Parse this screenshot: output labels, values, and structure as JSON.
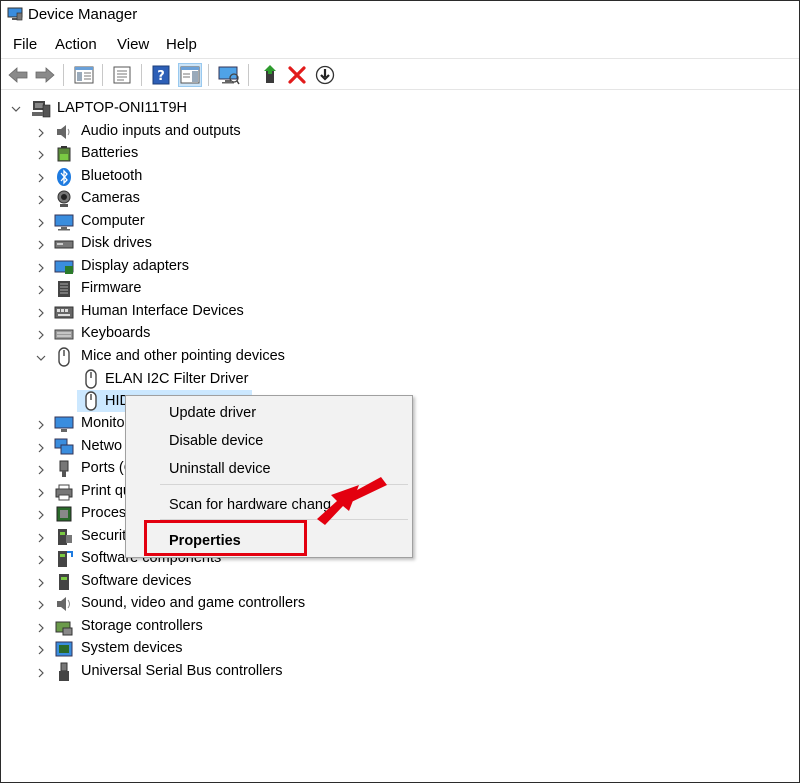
{
  "window": {
    "title": "Device Manager"
  },
  "menu": [
    "File",
    "Action",
    "View",
    "Help"
  ],
  "toolbar": {
    "buttons": [
      "back-icon",
      "forward-icon",
      "show-hide-console-tree-icon",
      "properties-icon",
      "help-icon",
      "action-pane-icon",
      "scan-hardware-icon",
      "update-driver-icon",
      "uninstall-device-icon",
      "disable-device-icon"
    ]
  },
  "tree": {
    "root": "LAPTOP-ONI11T9H",
    "categories": [
      "Audio inputs and outputs",
      "Batteries",
      "Bluetooth",
      "Cameras",
      "Computer",
      "Disk drives",
      "Display adapters",
      "Firmware",
      "Human Interface Devices",
      "Keyboards",
      "Mice and other pointing devices",
      "Monito",
      "Netwo",
      "Ports (C",
      "Print qu",
      "Process",
      "Securit",
      "Software components",
      "Software devices",
      "Sound, video and game controllers",
      "Storage controllers",
      "System devices",
      "Universal Serial Bus controllers"
    ],
    "mice_children": [
      "ELAN I2C Filter Driver",
      "HID"
    ]
  },
  "context_menu": {
    "items": [
      "Update driver",
      "Disable device",
      "Uninstall device",
      "Scan for hardware chang",
      "Properties"
    ]
  },
  "colors": {
    "highlight": "#e3000f",
    "selection": "#cce8ff"
  }
}
